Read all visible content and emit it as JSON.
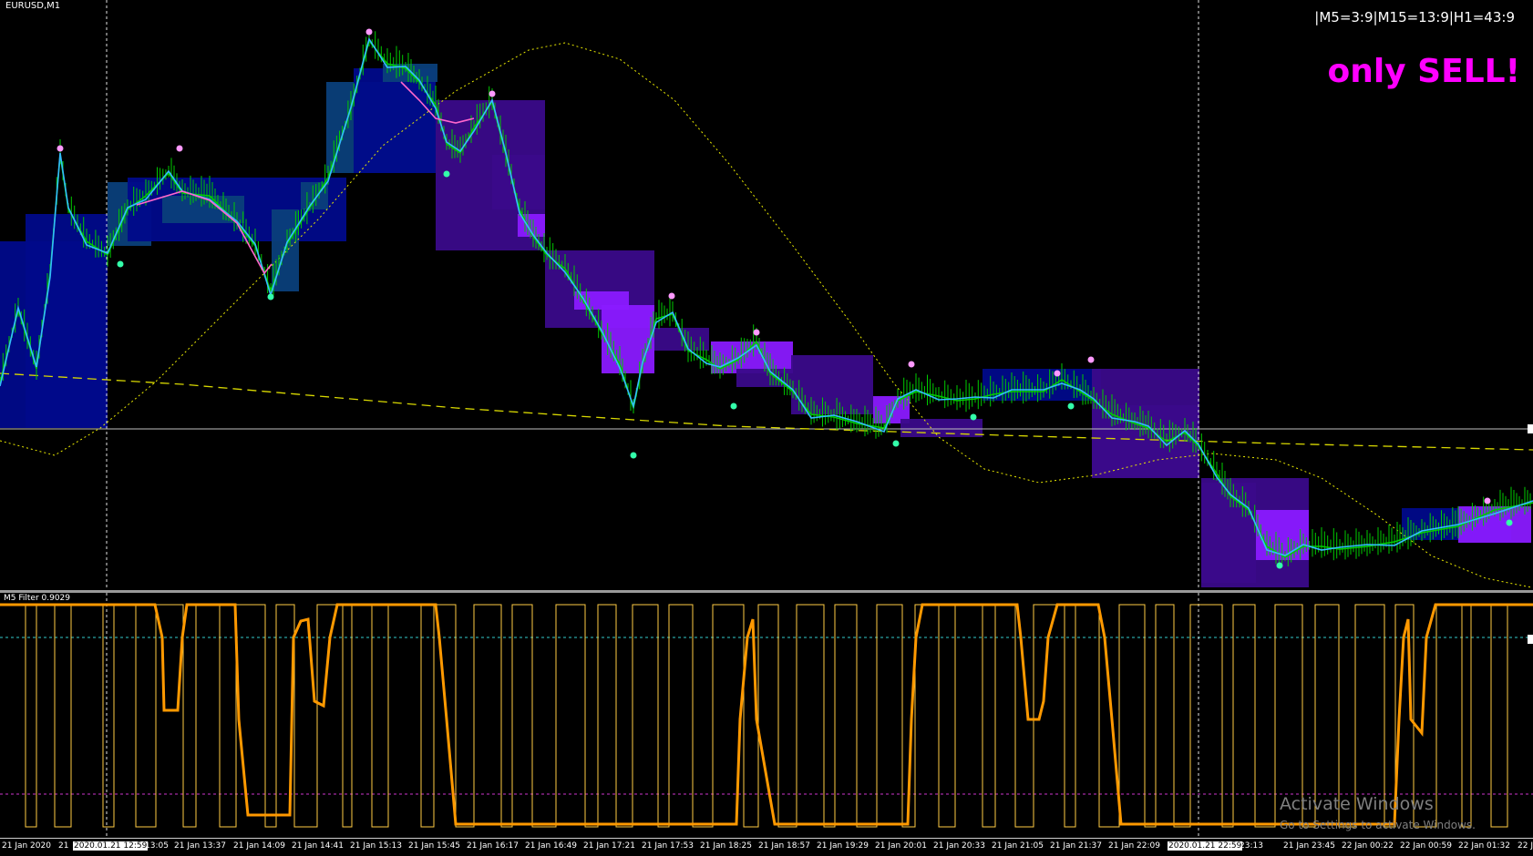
{
  "window": {
    "symbol_label": "EURUSD,M1"
  },
  "overlay": {
    "mtf_readout": "|M5=3:9|M15=13:9|H1=43:9",
    "signal_text": "only SELL!"
  },
  "indicator_pane": {
    "label": "M5 Filter 0.9029"
  },
  "watermark": {
    "line1": "Activate Windows",
    "line2": "Go to Settings to activate Windows."
  },
  "time_axis": {
    "labels": [
      {
        "text": "21 Jan 2020",
        "highlight": false
      },
      {
        "text": "21",
        "highlight": false
      },
      {
        "text": "2020.01.21 12:59",
        "highlight": true
      },
      {
        "text": "13:05",
        "highlight": false
      },
      {
        "text": "21 Jan 13:37",
        "highlight": false
      },
      {
        "text": "21 Jan 14:09",
        "highlight": false
      },
      {
        "text": "21 Jan 14:41",
        "highlight": false
      },
      {
        "text": "21 Jan 15:13",
        "highlight": false
      },
      {
        "text": "21 Jan 15:45",
        "highlight": false
      },
      {
        "text": "21 Jan 16:17",
        "highlight": false
      },
      {
        "text": "21 Jan 16:49",
        "highlight": false
      },
      {
        "text": "21 Jan 17:21",
        "highlight": false
      },
      {
        "text": "21 Jan 17:53",
        "highlight": false
      },
      {
        "text": "21 Jan 18:25",
        "highlight": false
      },
      {
        "text": "21 Jan 18:57",
        "highlight": false
      },
      {
        "text": "21 Jan 19:29",
        "highlight": false
      },
      {
        "text": "21 Jan 20:01",
        "highlight": false
      },
      {
        "text": "21 Jan 20:33",
        "highlight": false
      },
      {
        "text": "21 Jan 21:05",
        "highlight": false
      },
      {
        "text": "21 Jan 21:37",
        "highlight": false
      },
      {
        "text": "21 Jan 22:09",
        "highlight": false
      },
      {
        "text": "2020.01.21 22:59",
        "highlight": true
      },
      {
        "text": "23:13",
        "highlight": false
      },
      {
        "text": "21 Jan 23:45",
        "highlight": false
      },
      {
        "text": "22 Jan 00:22",
        "highlight": false
      },
      {
        "text": "22 Jan 00:59",
        "highlight": false
      },
      {
        "text": "22 Jan 01:32",
        "highlight": false
      },
      {
        "text": "22 J",
        "highlight": false
      }
    ]
  },
  "colors": {
    "background": "#000000",
    "price_line": "#00cc00",
    "ma_cyan": "#33bbff",
    "ma_pink": "#ff66cc",
    "dotted_curve": "#e8e800",
    "dashed_level": "#d8d800",
    "box_blue": "#000a8a",
    "box_teal": "#0a3f7a",
    "box_purple": "#3a0a8a",
    "box_violet": "#8a1aff",
    "top_dot": "#ff99ff",
    "bottom_dot": "#33ffaa",
    "osc_thick": "#ff9900",
    "osc_thin": "#ffcc44",
    "osc_upper_level": "#33cccc",
    "osc_lower_level": "#cc33cc",
    "signal": "#ff00ff"
  }
}
